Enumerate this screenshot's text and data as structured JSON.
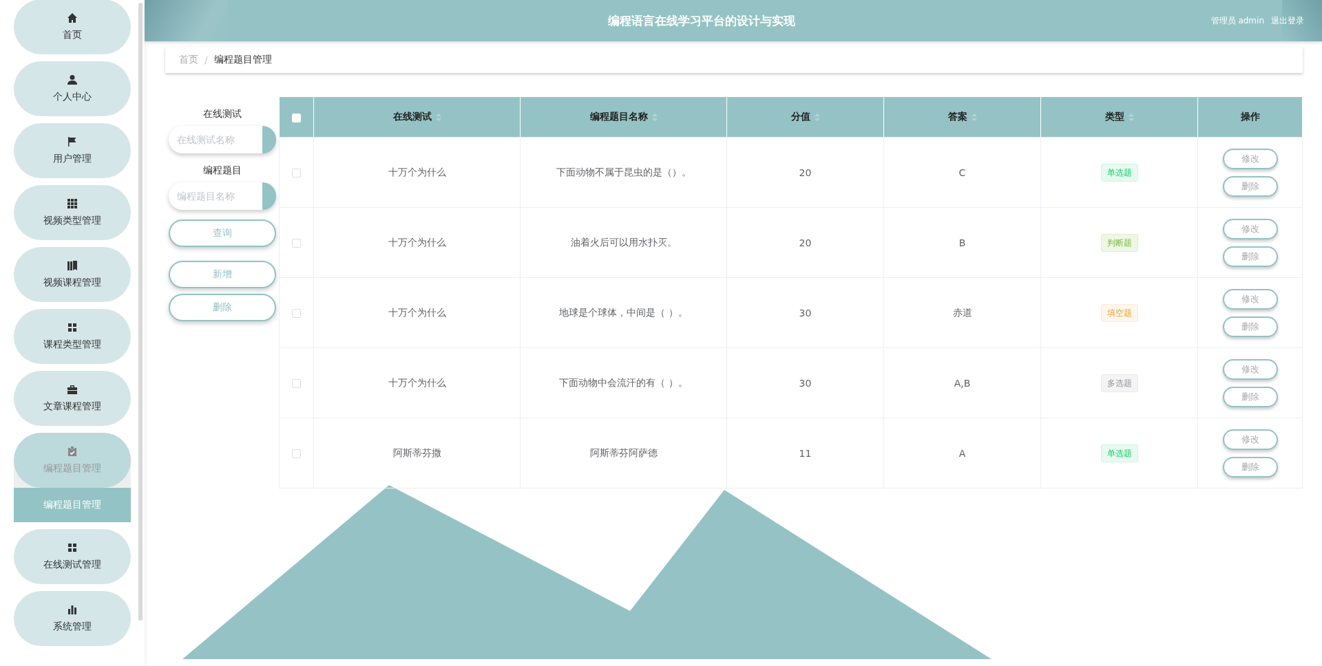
{
  "sidebar": {
    "items": [
      {
        "label": "首页",
        "expanded": false
      },
      {
        "label": "个人中心",
        "expanded": false
      },
      {
        "label": "用户管理",
        "expanded": false
      },
      {
        "label": "视频类型管理",
        "expanded": false
      },
      {
        "label": "视频课程管理",
        "expanded": false
      },
      {
        "label": "课程类型管理",
        "expanded": false
      },
      {
        "label": "文章课程管理",
        "expanded": false
      },
      {
        "label": "编程题目管理",
        "expanded": true,
        "children": [
          {
            "label": "编程题目管理",
            "selected": true
          }
        ]
      },
      {
        "label": "在线测试管理",
        "expanded": false
      },
      {
        "label": "系统管理",
        "expanded": false
      }
    ]
  },
  "header": {
    "title": "编程语言在线学习平台的设计与实现",
    "user": "管理员 admin",
    "logout": "退出登录"
  },
  "breadcrumb": {
    "items": [
      "首页",
      "编程题目管理"
    ],
    "separator": "/"
  },
  "search": {
    "fields": [
      {
        "label": "在线测试",
        "placeholder": "在线测试名称"
      },
      {
        "label": "编程题目",
        "placeholder": "编程题目名称"
      }
    ],
    "query_button": "查询",
    "actions": [
      "新增",
      "删除"
    ]
  },
  "table": {
    "all_selected": false,
    "columns": [
      {
        "label": "在线测试",
        "sortable": true
      },
      {
        "label": "编程题目名称",
        "sortable": true
      },
      {
        "label": "分值",
        "sortable": true
      },
      {
        "label": "答案",
        "sortable": true
      },
      {
        "label": "类型",
        "sortable": true
      },
      {
        "label": "操作",
        "sortable": false
      }
    ],
    "rows": [
      {
        "selected": false,
        "cells": [
          "十万个为什么",
          "下面动物不属于昆虫的是（）。",
          "20",
          "C"
        ],
        "type": {
          "label": "单选题",
          "kind": "success"
        },
        "actions": [
          "修改",
          "删除"
        ]
      },
      {
        "selected": false,
        "cells": [
          "十万个为什么",
          "油着火后可以用水扑灭。",
          "20",
          "B"
        ],
        "type": {
          "label": "判断题",
          "kind": "lime"
        },
        "actions": [
          "修改",
          "删除"
        ]
      },
      {
        "selected": false,
        "cells": [
          "十万个为什么",
          "地球是个球体，中间是（ ）。",
          "30",
          "赤道"
        ],
        "type": {
          "label": "填空题",
          "kind": "warning"
        },
        "actions": [
          "修改",
          "删除"
        ]
      },
      {
        "selected": false,
        "cells": [
          "十万个为什么",
          "下面动物中会流汗的有（ ）。",
          "30",
          "A,B"
        ],
        "type": {
          "label": "多选题",
          "kind": "info"
        },
        "actions": [
          "修改",
          "删除"
        ]
      },
      {
        "selected": false,
        "cells": [
          "阿斯蒂芬撒",
          "阿斯蒂芬阿萨德",
          "11",
          "A"
        ],
        "type": {
          "label": "单选题",
          "kind": "success"
        },
        "actions": [
          "修改",
          "删除"
        ]
      }
    ]
  }
}
